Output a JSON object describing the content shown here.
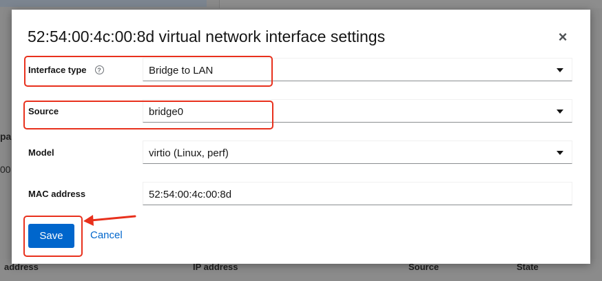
{
  "background": {
    "fragments": [
      "pac",
      "00"
    ],
    "footer_headers": [
      "address",
      "IP address",
      "Source",
      "State"
    ]
  },
  "dialog": {
    "title": "52:54:00:4c:00:8d virtual network interface settings",
    "close_glyph": "×",
    "fields": {
      "interface_type": {
        "label": "Interface type",
        "value": "Bridge to LAN"
      },
      "source": {
        "label": "Source",
        "value": "bridge0"
      },
      "model": {
        "label": "Model",
        "value": "virtio (Linux, perf)"
      },
      "mac_address": {
        "label": "MAC address",
        "value": "52:54:00:4c:00:8d"
      }
    },
    "help_glyph": "?",
    "save_label": "Save",
    "cancel_label": "Cancel"
  },
  "colors": {
    "primary": "#0066cc",
    "annotation": "#e8301c"
  },
  "icons": [
    "help-icon",
    "close-icon",
    "dropdown-caret-icon"
  ]
}
